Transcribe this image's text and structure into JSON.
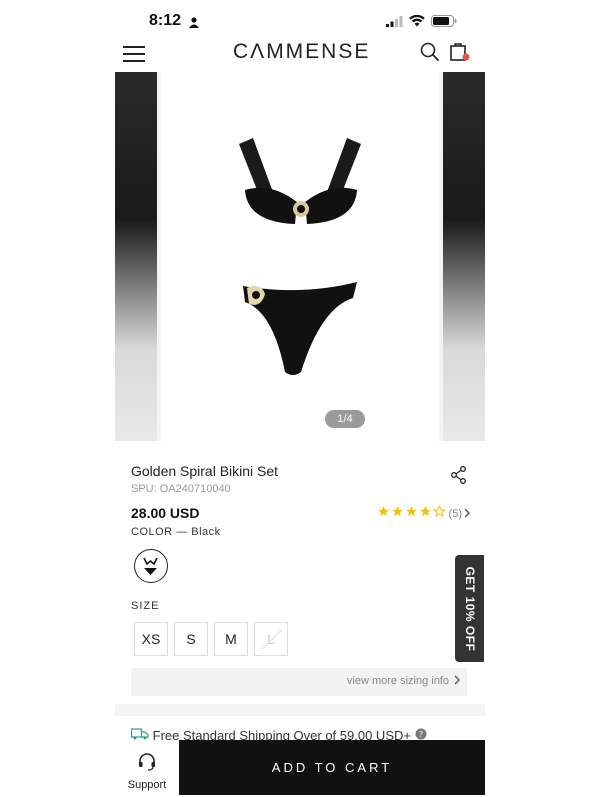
{
  "status_bar": {
    "time": "8:12"
  },
  "header": {
    "logo": "CΛMMENSE"
  },
  "gallery": {
    "page_indicator": "1/4"
  },
  "product": {
    "title": "Golden Spiral Bikini Set",
    "spu": "SPU: OA240710040",
    "price": "28.00 USD",
    "rating_value": 4,
    "rating_max": 5,
    "review_count": "(5)",
    "color_label": "COLOR",
    "color_value": "— Black",
    "size_label": "SIZE",
    "sizes": [
      {
        "label": "XS",
        "available": true
      },
      {
        "label": "S",
        "available": true
      },
      {
        "label": "M",
        "available": true
      },
      {
        "label": "L",
        "available": false
      }
    ],
    "sizing_link": "view more sizing info",
    "shipping_text": "Free Standard Shipping Over of 59.00 USD+"
  },
  "promo": {
    "label": "GET 10% OFF"
  },
  "bottom_bar": {
    "support_label": "Support",
    "add_to_cart_label": "ADD TO CART"
  },
  "colors": {
    "accent_dot": "#e8553a",
    "star": "#f2c200",
    "button_bg": "#111111"
  },
  "icons": [
    "person-icon",
    "signal-icon",
    "wifi-icon",
    "battery-icon",
    "hamburger-icon",
    "search-icon",
    "bag-icon",
    "share-icon",
    "star-icon",
    "chevron-right-icon",
    "swatch-bikini-icon",
    "headset-icon",
    "truck-icon",
    "help-icon"
  ]
}
